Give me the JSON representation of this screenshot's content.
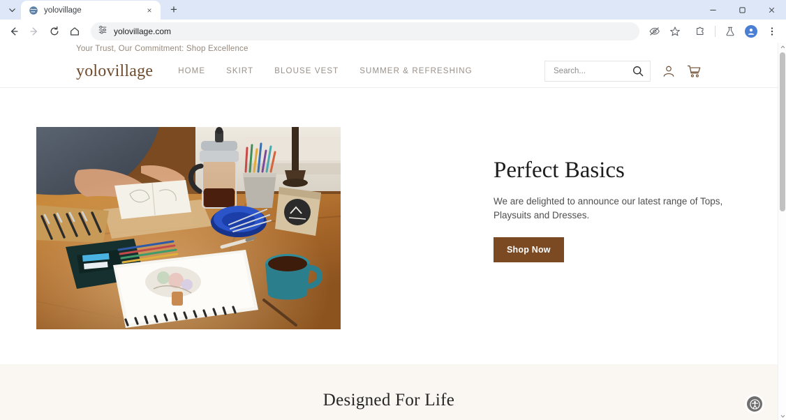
{
  "browser": {
    "tab": {
      "title": "yolovillage",
      "favicon": "globe-icon",
      "close_label": "×"
    },
    "tab_search_label": "tab-search-chevron",
    "new_tab_label": "+",
    "window_controls": {
      "minimize": "–",
      "maximize": "□",
      "close": "✕"
    },
    "toolbar": {
      "back": "back-arrow",
      "forward": "forward-arrow",
      "reload": "reload-arrow",
      "home": "home-icon",
      "site_info": "site-settings-icon",
      "url": "yolovillage.com",
      "tracking_protection": "eye-slash-icon",
      "bookmark": "star-icon",
      "extensions": "puzzle-piece-icon",
      "labs": "flask-icon",
      "profile": "profile-avatar-icon",
      "menu": "three-dot-menu-icon"
    }
  },
  "site": {
    "announcement": "Your Trust, Our Commitment: Shop Excellence",
    "logo": "yolovillage",
    "nav": [
      {
        "label": "HOME"
      },
      {
        "label": "SKIRT"
      },
      {
        "label": "BLOUSE VEST"
      },
      {
        "label": "SUMMER & REFRESHING"
      }
    ],
    "search": {
      "placeholder": "Search...",
      "icon": "search-icon"
    },
    "account_icon": "user-account-icon",
    "cart_icon": "shopping-cart-icon",
    "hero": {
      "title": "Perfect Basics",
      "subtitle": "We are delighted to announce our latest range of Tops, Playsuits and Dresses.",
      "cta": "Shop Now",
      "image_alt": "desk-scene-sketchbook-french-press-coffee-mug"
    },
    "section2": {
      "heading": "Designed For Life"
    },
    "accessibility_widget": "accessibility-icon"
  },
  "colors": {
    "brand_brown": "#7b4a22",
    "logo_brown": "#6e4b2d",
    "nav_gray": "#9a9089",
    "section_cream": "#faf6f2",
    "chrome_blue": "#dee7f8"
  }
}
